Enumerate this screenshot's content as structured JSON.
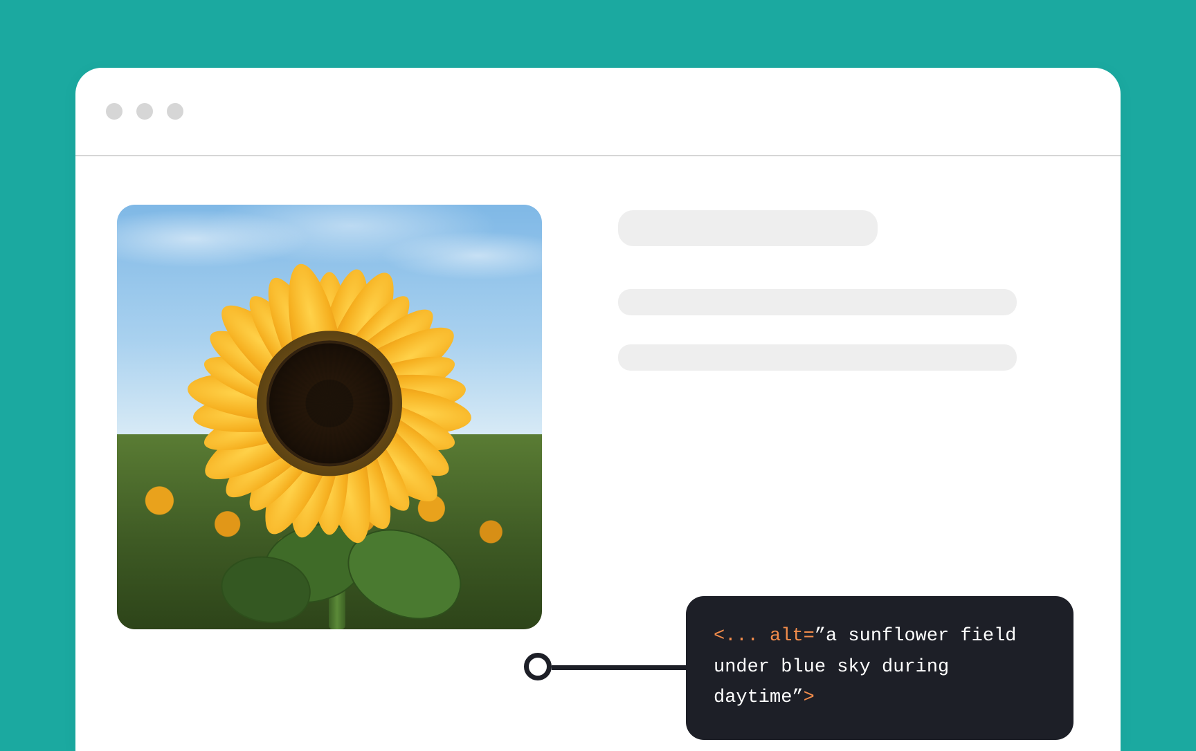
{
  "browser": {
    "traffic_lights": 3
  },
  "image": {
    "subject": "sunflower-photo",
    "alt_shown_in_callout": "a sunflower field under blue sky during daytime"
  },
  "placeholders": {
    "title_bar": true,
    "line_count": 2
  },
  "callout": {
    "bracket_open": "<... ",
    "attr_name": "alt=",
    "quote_open": "”",
    "alt_value": "a sunflower field under blue sky during daytime",
    "quote_close": "”",
    "bracket_close": ">"
  }
}
